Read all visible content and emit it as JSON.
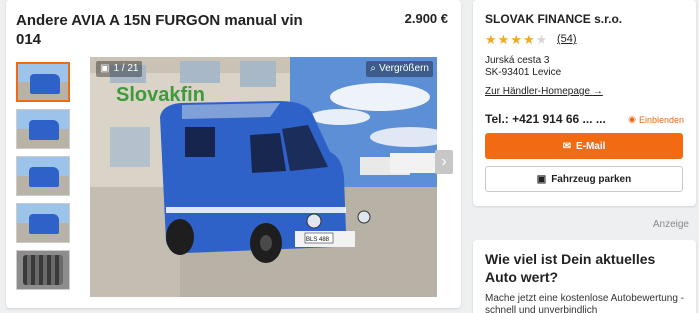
{
  "listing": {
    "title": "Andere AVIA A 15N FURGON manual vin 014",
    "price": "2.900 €",
    "image_counter": "1 / 21",
    "zoom_label": "Vergrößern",
    "truck_sign": "Slovakfin",
    "plate": "BLS 488"
  },
  "dealer": {
    "name": "SLOVAK FINANCE s.r.o.",
    "rating_stars": 4,
    "rating_count": "(54)",
    "street": "Jurská cesta 3",
    "city": "SK-93401 Levice",
    "homepage_link": "Zur Händler-Homepage",
    "phone": "Tel.: +421 914 66 ... ...",
    "show_phone": "Einblenden",
    "email_button": "E-Mail",
    "park_button": "Fahrzeug parken"
  },
  "ad_label": "Anzeige",
  "promo": {
    "title": "Wie viel ist Dein aktuelles Auto wert?",
    "text": "Mache jetzt eine kostenlose Autobewertung - schnell und unverbindlich"
  },
  "colors": {
    "accent": "#f26a12",
    "star": "#f3a81d",
    "van": "#2f62c9"
  },
  "icons": [
    "image-icon",
    "zoom-icon",
    "chevron-right-icon",
    "star-icon",
    "arrow-right-icon",
    "eye-icon",
    "mail-icon",
    "car-icon"
  ]
}
